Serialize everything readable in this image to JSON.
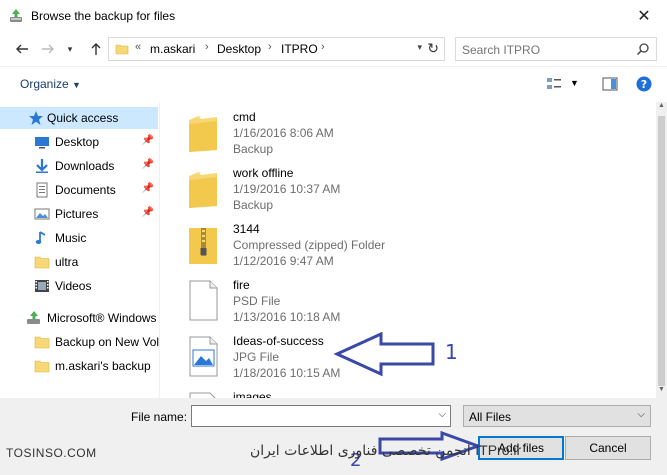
{
  "window": {
    "title": "Browse the backup for files"
  },
  "address": {
    "crumbs": [
      "m.askari",
      "Desktop",
      "ITPRO"
    ],
    "overflow_glyph": "«"
  },
  "search": {
    "placeholder": "Search ITPRO"
  },
  "toolbar": {
    "organize_label": "Organize"
  },
  "nav": {
    "quick_access": "Quick access",
    "items": [
      {
        "label": "Desktop",
        "icon": "desktop-icon",
        "pinned": true
      },
      {
        "label": "Downloads",
        "icon": "download-icon",
        "pinned": true
      },
      {
        "label": "Documents",
        "icon": "documents-icon",
        "pinned": true
      },
      {
        "label": "Pictures",
        "icon": "pictures-icon",
        "pinned": true
      },
      {
        "label": "Music",
        "icon": "music-icon",
        "pinned": false
      },
      {
        "label": "ultra",
        "icon": "folder-icon",
        "pinned": false
      },
      {
        "label": "Videos",
        "icon": "videos-icon",
        "pinned": false
      }
    ],
    "windows_backup": "Microsoft® Windows",
    "backup_items": [
      {
        "label": "Backup on New Vol",
        "icon": "folder-icon"
      },
      {
        "label": "m.askari's backup",
        "icon": "folder-icon"
      }
    ]
  },
  "files": [
    {
      "name": "cmd",
      "date": "1/16/2016 8:06 AM",
      "type": "Backup",
      "icon": "folder-icon"
    },
    {
      "name": "work offline",
      "date": "1/19/2016 10:37 AM",
      "type": "Backup",
      "icon": "folder-icon"
    },
    {
      "name": "3144",
      "type": "Compressed (zipped) Folder",
      "date": "1/12/2016 9:47 AM",
      "icon": "zip-folder-icon"
    },
    {
      "name": "fire",
      "type": "PSD File",
      "date": "1/13/2016 10:18 AM",
      "icon": "file-icon"
    },
    {
      "name": "Ideas-of-success",
      "type": "JPG File",
      "date": "1/18/2016 10:15 AM",
      "icon": "image-file-icon"
    },
    {
      "name": "images",
      "type": "",
      "date": "",
      "icon": "file-icon"
    }
  ],
  "bottom": {
    "filename_label": "File name:",
    "filename_value": "",
    "filetype_value": "All Files",
    "add_files_label": "Add files",
    "cancel_label": "Cancel"
  },
  "annotations": {
    "arrow1_label": "1",
    "arrow2_label": "2"
  },
  "watermark": {
    "left": "TOSINSO.COM",
    "right": "انجمن تخصصی فناوری اطلاعات ایران",
    "right_brand": "ITPro.ir"
  },
  "colors": {
    "selected": "#cce8ff",
    "accent": "#0078d7",
    "folder": "#f8d775",
    "annotation": "#3a48a8"
  }
}
